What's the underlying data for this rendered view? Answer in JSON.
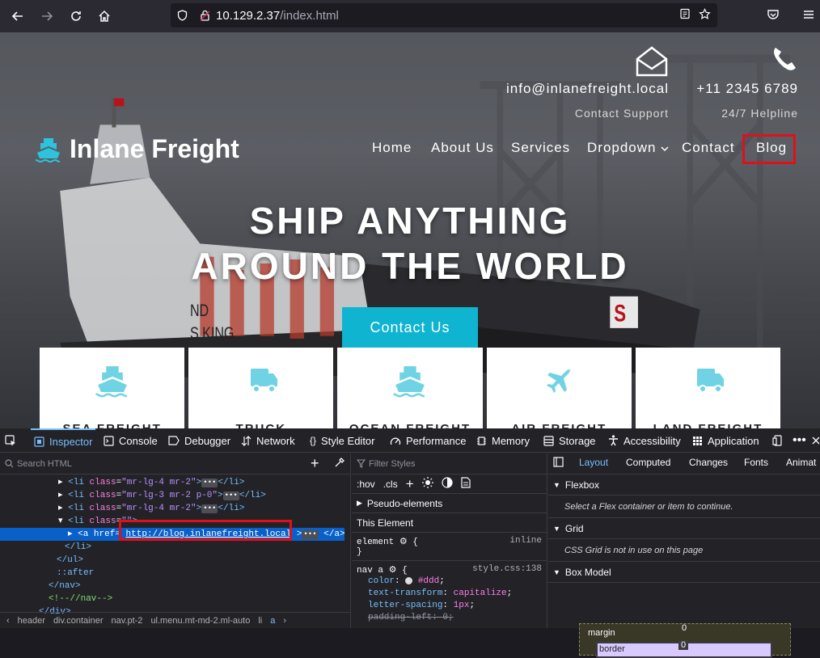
{
  "browser": {
    "url_host": "10.129.2.37",
    "url_path": "/index.html"
  },
  "site": {
    "logo_text": "Inlane Freight",
    "email": "info@inlanefreight.local",
    "email_sub": "Contact Support",
    "phone": "+11 2345 6789",
    "phone_sub": "24/7 Helpline",
    "menu": [
      "Home",
      "About Us",
      "Services",
      "Dropdown",
      "Contact",
      "Blog"
    ],
    "hero_line1": "SHIP ANYTHING",
    "hero_line2": "AROUND THE WORLD",
    "cta_label": "Contact Us",
    "cards": [
      "SEA FREIGHT",
      "TRUCK",
      "OCEAN FREIGHT",
      "AIR FREIGHT",
      "LAND FREIGHT"
    ],
    "accent": "#0fb4d0"
  },
  "devtools": {
    "tabs": [
      "Inspector",
      "Console",
      "Debugger",
      "Network",
      "Style Editor",
      "Performance",
      "Memory",
      "Storage",
      "Accessibility",
      "Application"
    ],
    "search_placeholder": "Search HTML",
    "tree": {
      "li1_class": "mr-lg-4 mr-2",
      "li2_class": "mr-lg-3 mr-2 p-0",
      "li3_class": "mr-lg-4 mr-2",
      "li4_class": "",
      "href": "http://blog.inlanefreight.local",
      "after": "::after",
      "comment": "<!--//nav-->"
    },
    "breadcrumbs": [
      "header",
      "div.container",
      "nav.pt-2",
      "ul.menu.mt-md-2.ml-auto",
      "li",
      "a"
    ],
    "filter_placeholder": "Filter Styles",
    "hov": ":hov",
    "cls": ".cls",
    "pseudo_elements": "Pseudo-elements",
    "this_element": "This Element",
    "rule1_selector": "element",
    "rule1_src": "inline",
    "rule2_selector": "nav a",
    "rule2_src": "style.css:138",
    "rule2_props": [
      {
        "name": "color",
        "value": "#ddd"
      },
      {
        "name": "text-transform",
        "value": "capitalize"
      },
      {
        "name": "letter-spacing",
        "value": "1px"
      },
      {
        "name": "padding-left",
        "value": "0"
      }
    ],
    "right_tabs": [
      "Layout",
      "Computed",
      "Changes",
      "Fonts",
      "Animat"
    ],
    "flexbox_title": "Flexbox",
    "flexbox_msg": "Select a Flex container or item to continue.",
    "grid_title": "Grid",
    "grid_msg": "CSS Grid is not in use on this page",
    "boxmodel_title": "Box Model",
    "margin_label": "margin",
    "border_label": "border",
    "margin_val": "0",
    "border_val": "0"
  }
}
